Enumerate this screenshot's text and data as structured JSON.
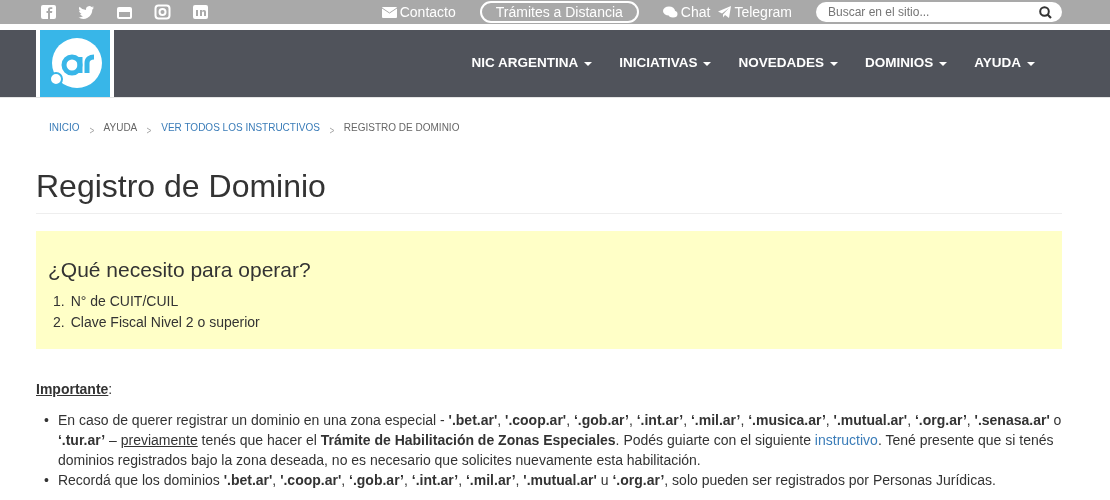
{
  "topbar": {
    "contact": "Contacto",
    "remote_button": "Trámites a Distancia",
    "chat": "Chat",
    "telegram": "Telegram",
    "search": {
      "placeholder": "Buscar en el sitio..."
    }
  },
  "navbar": {
    "menu": [
      {
        "label": "NIC ARGENTINA"
      },
      {
        "label": "INICIATIVAS"
      },
      {
        "label": "NOVEDADES"
      },
      {
        "label": "DOMINIOS"
      },
      {
        "label": "AYUDA"
      }
    ]
  },
  "breadcrumb": [
    {
      "label": "INICIO",
      "link": true
    },
    {
      "label": "AYUDA",
      "link": false
    },
    {
      "label": "VER TODOS LOS INSTRUCTIVOS",
      "link": true
    },
    {
      "label": "REGISTRO DE DOMINIO",
      "link": false
    }
  ],
  "title": "Registro de Dominio",
  "requirements": {
    "heading": "¿Qué necesito para operar?",
    "items": [
      {
        "number": "1.",
        "text": "N° de CUIT/CUIL"
      },
      {
        "number": "2.",
        "text": "Clave Fiscal Nivel 2 o superior"
      }
    ]
  },
  "important": {
    "label": "Importante",
    "suffix": ":"
  },
  "bullets": [
    {
      "marker": "•",
      "segments": [
        {
          "kind": "text",
          "text": "En caso de querer registrar un dominio en una zona especial - **'.bet.ar'**, **'.coop.ar'**, **‘.gob.ar’**, **‘.int.ar’**, **‘.mil.ar’**, **‘.musica.ar’**, **'.mutual.ar'**, **‘.org.ar’**, **'.senasa.ar'** o **‘.tur.ar’** – "
        },
        {
          "kind": "underline",
          "text": "previamente"
        },
        {
          "kind": "text",
          "text": " tenés que hacer el **Trámite de Habilitación de Zonas Especiales**. Podés guiarte con el siguiente "
        },
        {
          "kind": "link",
          "text": "instructivo"
        },
        {
          "kind": "text",
          "text": ". Tené presente que si tenés dominios registrados bajo la zona deseada, no es necesario que solicites nuevamente esta habilitación."
        }
      ]
    },
    {
      "marker": "•",
      "segments": [
        {
          "kind": "text",
          "text": "Recordá que los dominios **'.bet.ar'**, **'.coop.ar'**, **‘.gob.ar’**, **‘.int.ar’**, **‘.mil.ar’**, **'.mutual.ar'** u **‘.org.ar’**, solo pueden ser registrados por Personas Jurídicas."
        }
      ]
    }
  ]
}
